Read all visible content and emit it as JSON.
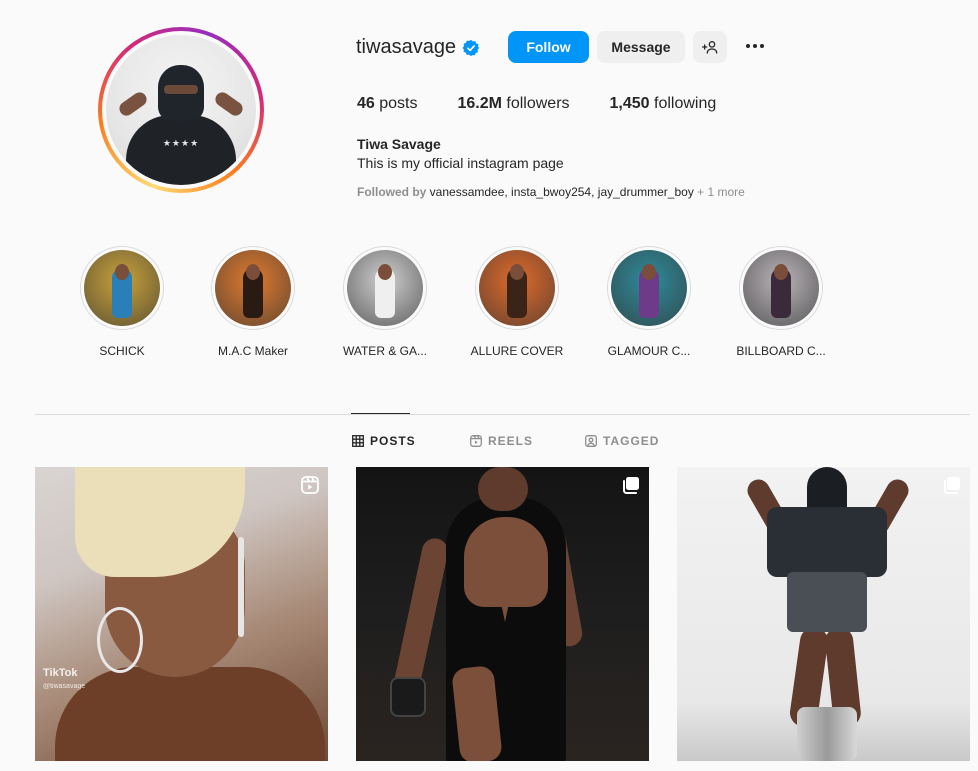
{
  "profile": {
    "username": "tiwasavage",
    "full_name": "Tiwa Savage",
    "bio": "This is my official instagram page",
    "verified": true,
    "avatar_logo_text": "★★★★",
    "stats": {
      "posts_value": "46",
      "posts_label": " posts",
      "followers_value": "16.2M",
      "followers_label": " followers",
      "following_value": "1,450",
      "following_label": " following"
    },
    "followed_by": {
      "prefix": "Followed by ",
      "names": "vanessamdee, insta_bwoy254, jay_drummer_boy",
      "more": " + 1 more"
    }
  },
  "actions": {
    "follow_label": "Follow",
    "message_label": "Message",
    "suggest_icon": "person-add-icon",
    "more_icon": "more-horizontal-icon"
  },
  "highlights": [
    {
      "label": "SCHICK",
      "bg": "#c9a23a",
      "figure": "#2a7fb8"
    },
    {
      "label": "M.A.C Maker",
      "bg": "#e07a2e",
      "figure": "#2a1a14"
    },
    {
      "label": "WATER & GA...",
      "bg": "#cfcfcf",
      "figure": "#efefef"
    },
    {
      "label": "ALLURE COVER",
      "bg": "#e06a2a",
      "figure": "#3a2418"
    },
    {
      "label": "GLAMOUR C...",
      "bg": "#2e8a9a",
      "figure": "#6e3a8a"
    },
    {
      "label": "BILLBOARD C...",
      "bg": "#b8b3b8",
      "figure": "#3a2a3a"
    }
  ],
  "tabs": [
    {
      "label": "POSTS",
      "icon": "grid-icon",
      "active": true
    },
    {
      "label": "REELS",
      "icon": "reels-icon",
      "active": false
    },
    {
      "label": "TAGGED",
      "icon": "tagged-icon",
      "active": false
    }
  ],
  "posts": [
    {
      "badge_icon": "reel-icon",
      "overlay_title": "TikTok",
      "overlay_handle": "@tiwasavage"
    },
    {
      "badge_icon": "carousel-icon"
    },
    {
      "badge_icon": "carousel-icon"
    }
  ],
  "colors": {
    "accent": "#0095f6",
    "background": "#fafafa",
    "text": "#262626",
    "secondary_text": "#8e8e8e",
    "border": "#dbdbdb",
    "story_ring": [
      "#feda75",
      "#fa7e1e",
      "#d62976",
      "#962fbf"
    ]
  }
}
